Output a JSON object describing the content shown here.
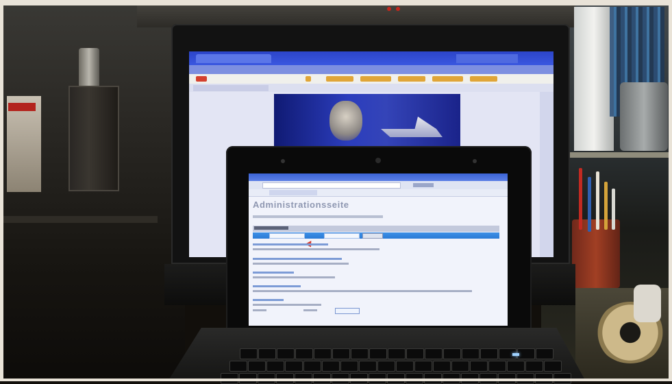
{
  "small_screen": {
    "page_heading": "Administrationsseite"
  }
}
